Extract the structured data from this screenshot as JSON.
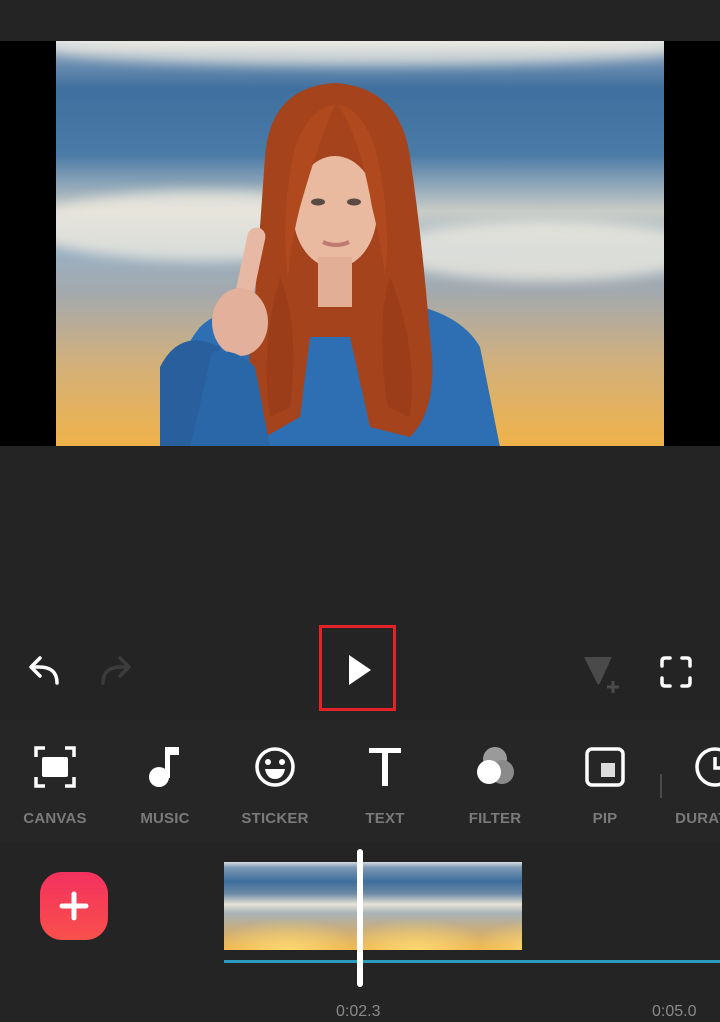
{
  "preview": {
    "description": "Video frame: red-haired woman in blue shirt pointing index finger, sky and sunset background",
    "colors": {
      "sky_top": "#3f6f9e",
      "sunset": "#f0b34a",
      "hair": "#a4431c",
      "shirt": "#2e6fb3"
    }
  },
  "controls": {
    "undo": {
      "icon": "undo-icon",
      "enabled": true
    },
    "redo": {
      "icon": "redo-icon",
      "enabled": false
    },
    "play": {
      "icon": "play-icon",
      "highlighted": true
    },
    "keyframe": {
      "icon": "keyframe-add-icon",
      "enabled": false
    },
    "fullscreen": {
      "icon": "fullscreen-icon"
    }
  },
  "toolbar": {
    "items": [
      {
        "id": "canvas",
        "label": "CANVAS",
        "icon": "canvas-icon"
      },
      {
        "id": "music",
        "label": "MUSIC",
        "icon": "music-note-icon"
      },
      {
        "id": "sticker",
        "label": "STICKER",
        "icon": "smiley-icon"
      },
      {
        "id": "text",
        "label": "TEXT",
        "icon": "text-icon"
      },
      {
        "id": "filter",
        "label": "FILTER",
        "icon": "filter-circles-icon"
      },
      {
        "id": "pip",
        "label": "PIP",
        "icon": "pip-icon"
      },
      {
        "id": "duration",
        "label": "DURATION",
        "icon": "clock-icon"
      }
    ]
  },
  "timeline": {
    "add_button": {
      "icon": "plus-icon",
      "color": "#f4315f"
    },
    "clip_frames": 3,
    "track_color": "#2a9bbf",
    "current_time": "0:02.3",
    "end_time": "0:05.0"
  },
  "colors": {
    "background": "#242424",
    "toolbar_bg": "#262626",
    "highlight": "#e3222a",
    "label": "#7a7a7a"
  }
}
